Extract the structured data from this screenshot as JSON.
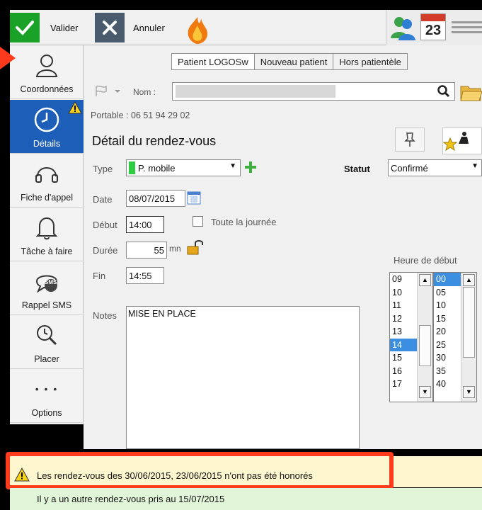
{
  "toolbar": {
    "validate_label": "Valider",
    "cancel_label": "Annuler",
    "calendar_day": "23"
  },
  "nav": {
    "items": [
      {
        "label": "Coordonnées"
      },
      {
        "label": "Détails"
      },
      {
        "label": "Fiche d'appel"
      },
      {
        "label": "Tâche à faire"
      },
      {
        "label": "Rappel SMS"
      },
      {
        "label": "Placer"
      },
      {
        "label": "Options"
      }
    ],
    "sms_badge": "SMS",
    "options_dots": "• • •"
  },
  "tabs": [
    {
      "label": "Patient LOGOSw",
      "selected": true
    },
    {
      "label": "Nouveau patient"
    },
    {
      "label": "Hors patientèle"
    }
  ],
  "patient": {
    "nom_label": "Nom :",
    "portable": "Portable : 06 51 94 29 02"
  },
  "detail": {
    "title": "Détail du rendez-vous",
    "type_label": "Type",
    "type_value": "P. mobile",
    "statut_label": "Statut",
    "statut_value": "Confirmé",
    "date_label": "Date",
    "date_value": "08/07/2015",
    "debut_label": "Début",
    "debut_value": "14:00",
    "all_day_label": "Toute la journée",
    "duree_label": "Durée",
    "duree_value": "55",
    "duree_unit": "mn",
    "fin_label": "Fin",
    "fin_value": "14:55",
    "notes_label": "Notes",
    "notes_value": "MISE EN PLACE",
    "heure_debut_label": "Heure de début"
  },
  "hours": [
    "09",
    "10",
    "11",
    "12",
    "13",
    "14",
    "15",
    "16",
    "17"
  ],
  "hours_selected": "14",
  "minutes": [
    "00",
    "05",
    "10",
    "15",
    "20",
    "25",
    "30",
    "35",
    "40"
  ],
  "minutes_selected": "00",
  "warning": "Les rendez-vous des 30/06/2015, 23/06/2015 n'ont pas été honorés",
  "info": "Il y a un autre rendez-vous pris au 15/07/2015",
  "colors": {
    "accent": "#1d5fb8",
    "warning_bg": "#fdf6cf",
    "info_bg": "#e1f6d8",
    "highlight": "#ff3a1d",
    "type_color": "#2ecc40"
  }
}
